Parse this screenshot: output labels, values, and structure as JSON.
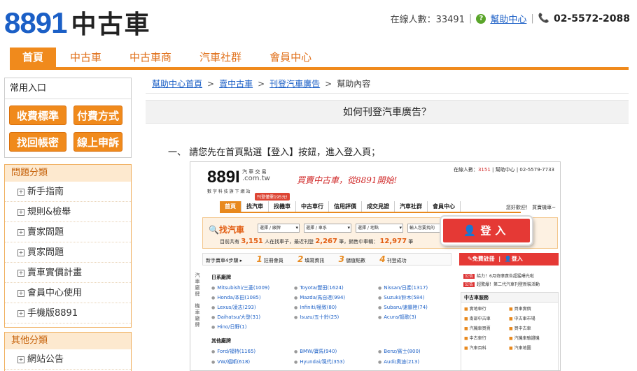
{
  "header": {
    "logo_num": "8891",
    "logo_text": "中古車",
    "online_label": "在線人數：33491",
    "help_label": "幫助中心",
    "phone": "02-5572-2088"
  },
  "nav": [
    "首頁",
    "中古車",
    "中古車商",
    "汽車社群",
    "會員中心"
  ],
  "sidebar": {
    "quick_title": "常用入口",
    "quick_buttons": [
      "收費標準",
      "付費方式",
      "找回帳密",
      "線上申訴"
    ],
    "category_title": "問題分類",
    "categories": [
      "新手指南",
      "規則&檢舉",
      "賣家問題",
      "買家問題",
      "賣車實價計畫",
      "會員中心使用",
      "手機版8891"
    ],
    "other_title": "其他分類",
    "other_items": [
      "網站公告"
    ]
  },
  "breadcrumb": [
    "幫助中心首頁",
    "賣中古車",
    "刊登汽車廣告",
    "幫助內容"
  ],
  "page_title": "如何刊登汽車廣告？",
  "step1": "一、 請您先在首頁點選【登入】按鈕，進入登入頁；",
  "shot": {
    "logo": "889I",
    "logo_sub": "汽 車 交 易",
    "logo_domain": ".com.tw",
    "logo_tagline": "數 字 科 技 旗 下 網 站",
    "badge": "刊登僅需195元!",
    "slogan": "買賣中古車，從8891開始!",
    "top_online": "在線人數：",
    "top_online_num": "3151",
    "top_help": "幫助中心",
    "top_phone": "02-5579-7733",
    "nav": [
      "首頁",
      "找汽車",
      "找機車",
      "中古車行",
      "信用評價",
      "成交見證",
      "汽車社群",
      "會員中心"
    ],
    "nav_right": "您好歡迎！ 買賣機車~",
    "search_label": "找汽車",
    "selects": [
      "選擇 / 廠牌",
      "選擇 / 車系",
      "選擇 / 地點",
      "輸入您要找的"
    ],
    "stats_prefix": "目前共有",
    "stats_cars": "3,151",
    "stats_mid1": "人在找車子，最近刊登",
    "stats_new": "2,267",
    "stats_mid2": "筆，銷售中車輛：",
    "stats_sale": "12,977",
    "stats_suffix": "筆",
    "login_big": "登入",
    "steps_label": "新手賣車4步驟 ▸",
    "steps": [
      "註冊會員",
      "填寫資訊",
      "儲值點數",
      "刊登成功"
    ],
    "register": "免費註冊",
    "login_small": "登入",
    "vtab1": "汽車廠牌",
    "vtab2": "機車廠牌",
    "japan_title": "日系廠牌",
    "japan_brands": [
      "Mitsubishi/三菱(1009)",
      "Toyota/豐田(1624)",
      "Nissan/日產(1317)",
      "Honda/本田(1085)",
      "Mazda/馬自達(994)",
      "Suzuki/鈴木(584)",
      "Lexus/凌志(293)",
      "Infiniti/極致(80)",
      "Subaru/速霸陸(74)",
      "Daihatsu/大發(31)",
      "Isuzu/五十鈴(25)",
      "Acura/謳歌(3)",
      "Hino/日野(1)"
    ],
    "other_title": "其他廠牌",
    "other_brands": [
      "Ford/福特(1165)",
      "BMW/寶馬(940)",
      "Benz/賓士(800)",
      "VW/福斯(618)",
      "Hyundai/現代(353)",
      "Audi/奧迪(213)"
    ],
    "ads": [
      "給力！6月奇摩廣告超猛曝光啦",
      "超驚爆！第二代汽車刊登新裝活動"
    ],
    "used_title": "中古車服務",
    "used_items": [
      "實地車行",
      "買車實價",
      "南部中古車",
      "中古車市場",
      "汽機車買賣",
      "買中古車",
      "中古車行",
      "汽機車驗證機",
      "汽車百科",
      "汽車地圖"
    ]
  }
}
